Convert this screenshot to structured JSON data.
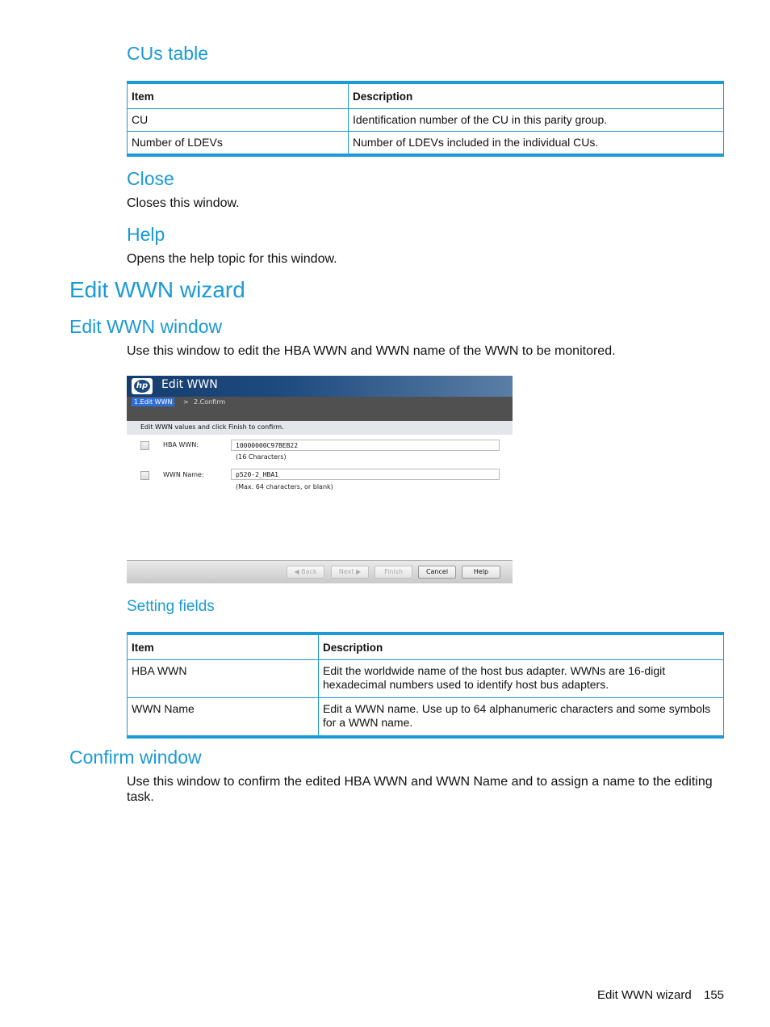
{
  "cus_section": {
    "heading": "CUs table",
    "table": {
      "headers": [
        "Item",
        "Description"
      ],
      "rows": [
        [
          "CU",
          "Identification number of the CU in this parity group."
        ],
        [
          "Number of LDEVs",
          "Number of LDEVs included in the individual CUs."
        ]
      ]
    }
  },
  "close_section": {
    "heading": "Close",
    "text": "Closes this window."
  },
  "help_section": {
    "heading": "Help",
    "text": "Opens the help topic for this window."
  },
  "wizard": {
    "title": "Edit WWN wizard",
    "edit_window": {
      "heading": "Edit WWN window",
      "intro": "Use this window to edit the HBA WWN and WWN name of the WWN to be monitored.",
      "dialog": {
        "logo_text": "hp",
        "title": "Edit WWN",
        "steps": {
          "active": "1.Edit WWN",
          "separator": ">",
          "next": "2.Confirm"
        },
        "instruction": "Edit WWN values and click Finish to confirm.",
        "fields": [
          {
            "label": "HBA WWN:",
            "value": "10000000C97BEB22",
            "hint": "(16 Characters)",
            "checked": false
          },
          {
            "label": "WWN Name:",
            "value": "p520-2_HBA1",
            "hint": "(Max. 64 characters, or blank)",
            "checked": false
          }
        ],
        "buttons": {
          "back": "◀ Back",
          "next": "Next ▶",
          "finish": "Finish",
          "cancel": "Cancel",
          "help": "Help"
        }
      },
      "setting_fields": {
        "heading": "Setting fields",
        "table": {
          "headers": [
            "Item",
            "Description"
          ],
          "rows": [
            [
              "HBA WWN",
              "Edit the worldwide name of the host bus adapter. WWNs are 16-digit hexadecimal numbers used to identify host bus adapters."
            ],
            [
              "WWN Name",
              "Edit a WWN name. Use up to 64 alphanumeric characters and some symbols for a WWN name."
            ]
          ]
        }
      }
    },
    "confirm_window": {
      "heading": "Confirm window",
      "intro": "Use this window to confirm the edited HBA WWN and WWN Name and to assign a name to the editing task."
    }
  },
  "page_footer": {
    "section": "Edit WWN wizard",
    "page_number": "155"
  }
}
